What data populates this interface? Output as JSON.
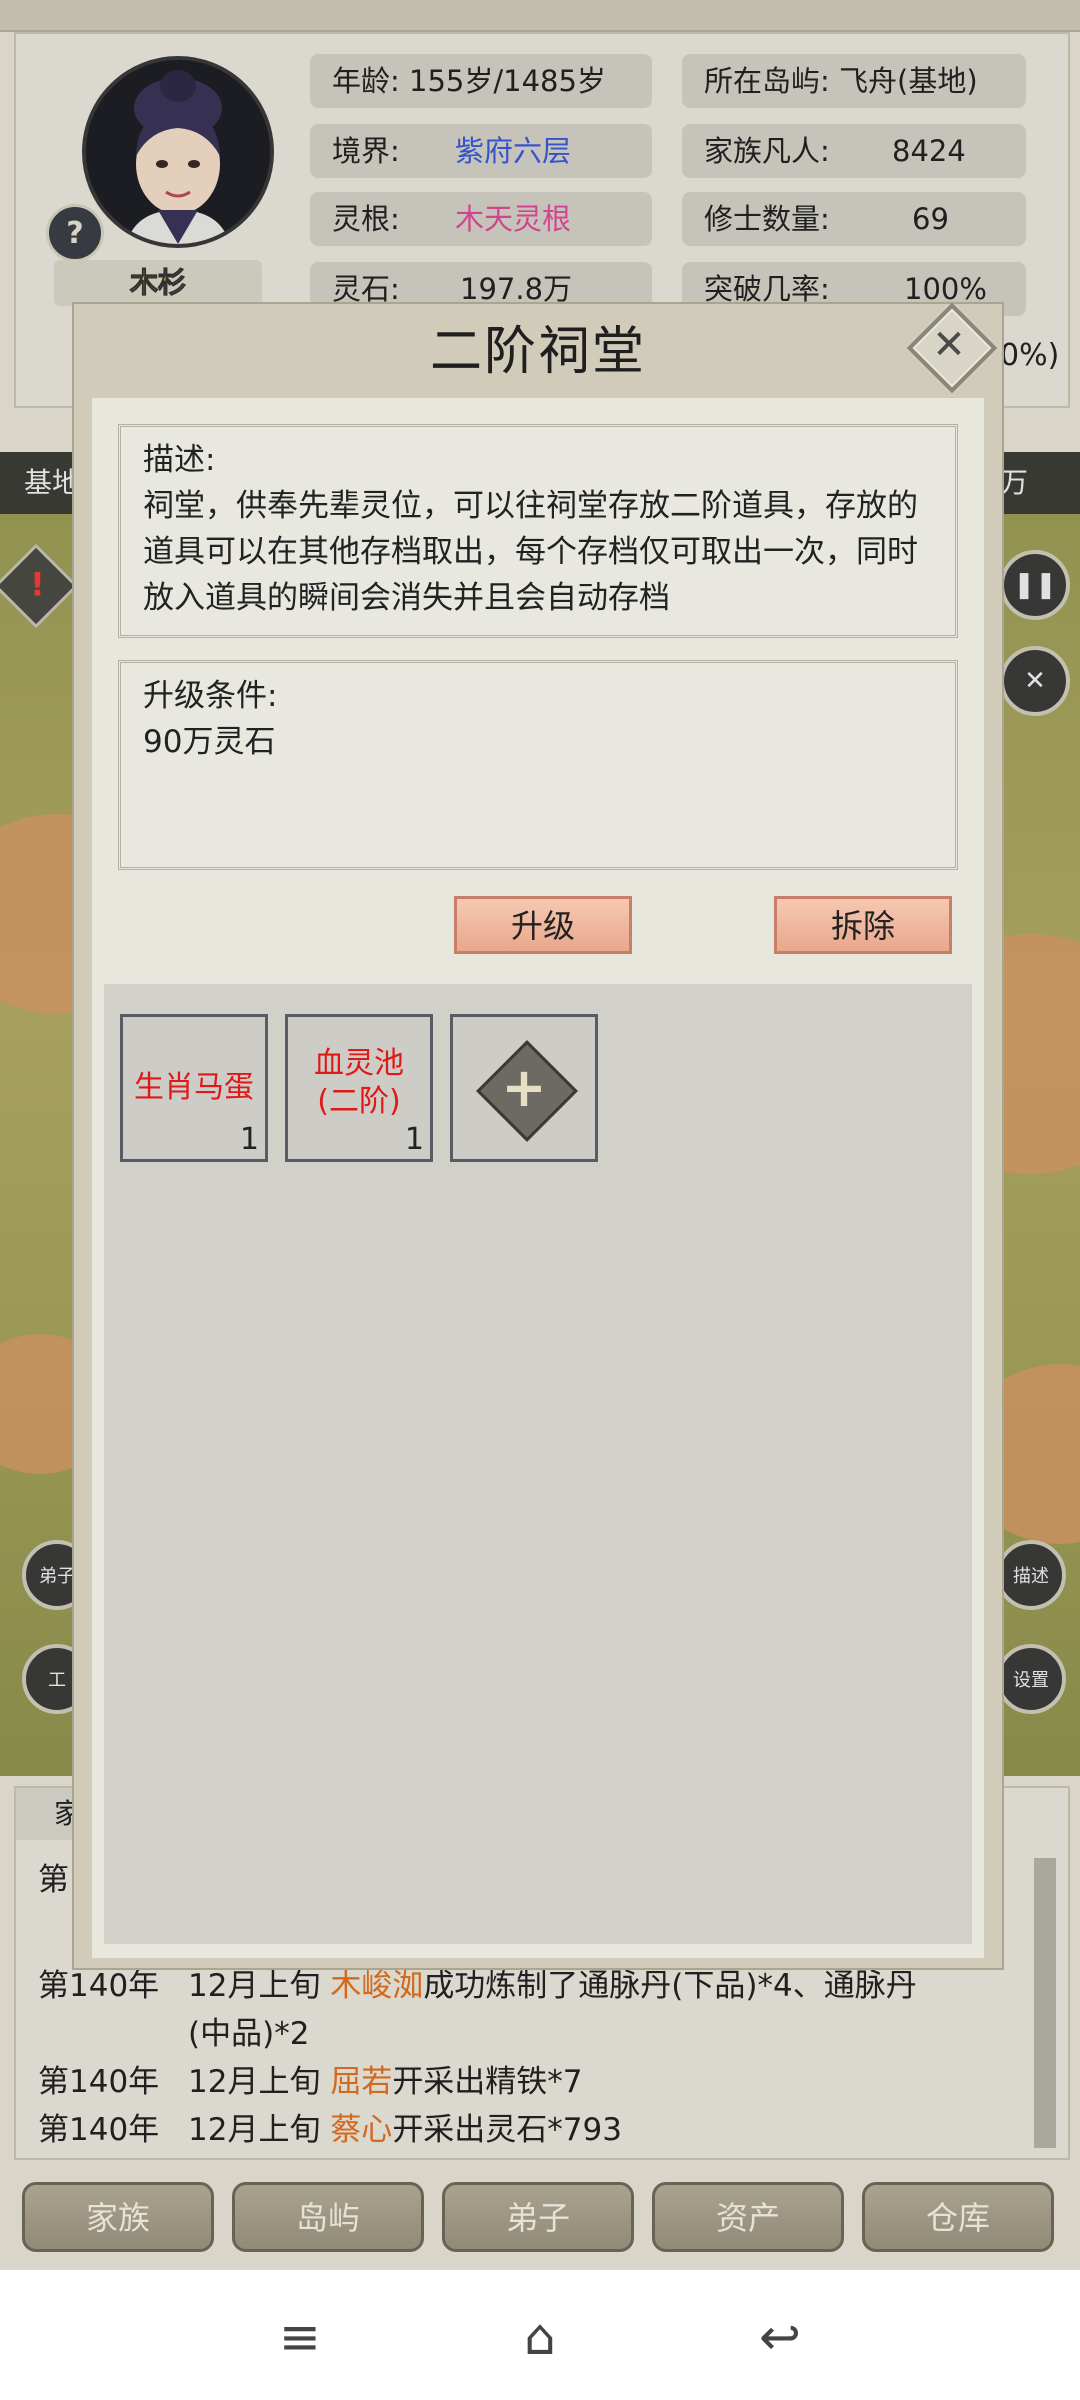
{
  "character": {
    "name": "木杉",
    "age_label": "年龄:",
    "age_value": "155岁/1485岁",
    "island_label": "所在岛屿:",
    "island_value": "飞舟(基地)",
    "realm_label": "境界:",
    "realm_value": "紫府六层",
    "family_label": "家族凡人:",
    "family_value": "8424",
    "root_label": "灵根:",
    "root_value": "木天灵根",
    "cultivators_label": "修士数量:",
    "cultivators_value": "69",
    "stone_label": "灵石:",
    "stone_value": "197.8万",
    "breakthrough_label": "突破几率:",
    "breakthrough_value": "100%",
    "partial_right": "0%)"
  },
  "background": {
    "strip_left": "基地",
    "strip_right": "万",
    "left_btn_1": "弟子",
    "left_btn_2": "工",
    "right_btn_1": "描述",
    "right_btn_2": "设置"
  },
  "dialog": {
    "title": "二阶祠堂",
    "description_title": "描述:",
    "description_text": "祠堂，供奉先辈灵位，可以往祠堂存放二阶道具，存放的道具可以在其他存档取出，每个存档仅可取出一次，同时放入道具的瞬间会消失并且会自动存档",
    "upgrade_title": "升级条件:",
    "upgrade_text": "90万灵石",
    "upgrade_button": "升级",
    "demolish_button": "拆除",
    "items": [
      {
        "name": "生肖马蛋",
        "qty": "1"
      },
      {
        "name": "血灵池(二阶)",
        "qty": "1"
      }
    ]
  },
  "log": {
    "tab": "家",
    "partial_first": "第",
    "lines": [
      {
        "year": "第140年",
        "time": "12月上旬",
        "person": "木峻洳",
        "text": "成功炼制了通脉丹(下品)*4、通脉丹",
        "cont": "(中品)*2"
      },
      {
        "year": "第140年",
        "time": "12月上旬",
        "person": "屈若",
        "text": "开采出精铁*7"
      },
      {
        "year": "第140年",
        "time": "12月上旬",
        "person": "蔡心",
        "text": "开采出灵石*793"
      }
    ]
  },
  "nav": [
    "家族",
    "岛屿",
    "弟子",
    "资产",
    "仓库"
  ],
  "system_nav": {
    "menu_icon": "≡",
    "home_icon": "⌂",
    "back_icon": "↩"
  },
  "colors": {
    "realm": "#3a5ad6",
    "root": "#e0489a",
    "item_name": "#e01818",
    "log_person": "#e0701e"
  }
}
